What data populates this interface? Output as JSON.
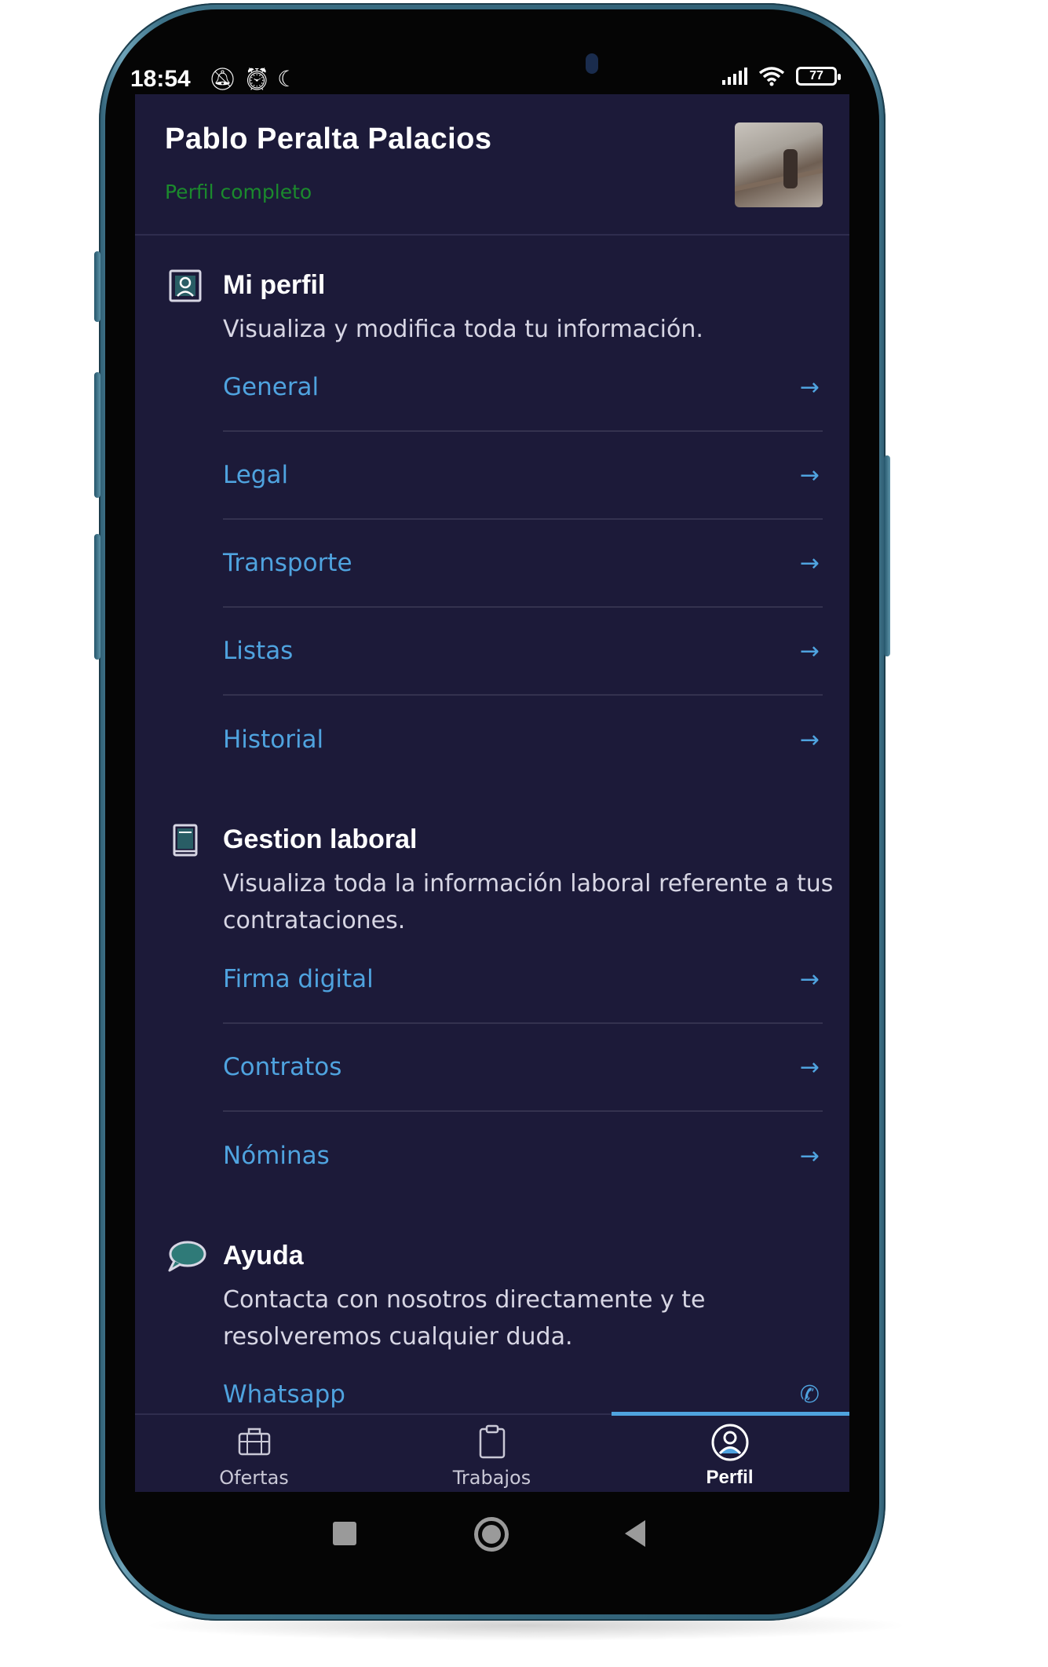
{
  "status_bar": {
    "time": "18:54",
    "battery": "77"
  },
  "header": {
    "user_name": "Pablo Peralta Palacios",
    "profile_status": "Perfil completo"
  },
  "sections": {
    "mi_perfil": {
      "title": "Mi perfil",
      "description": "Visualiza y modifica toda tu información.",
      "links": [
        "General",
        "Legal",
        "Transporte",
        "Listas",
        "Historial"
      ]
    },
    "gestion_laboral": {
      "title": "Gestion laboral",
      "description": "Visualiza toda la información laboral referente a tus contrataciones.",
      "links": [
        "Firma digital",
        "Contratos",
        "Nóminas"
      ]
    },
    "ayuda": {
      "title": "Ayuda",
      "description": "Contacta con nosotros directamente y te resolveremos cualquier duda.",
      "links": [
        "Whatsapp"
      ]
    }
  },
  "bottom_nav": {
    "items": [
      {
        "label": "Ofertas",
        "icon": "briefcase-icon"
      },
      {
        "label": "Trabajos",
        "icon": "clipboard-icon"
      },
      {
        "label": "Perfil",
        "icon": "user-circle-icon"
      }
    ],
    "active": "Perfil"
  },
  "colors": {
    "background": "#1c1a39",
    "link": "#4fa3df",
    "status_green": "#1b8a2d",
    "icon_teal": "#2f7a78"
  }
}
